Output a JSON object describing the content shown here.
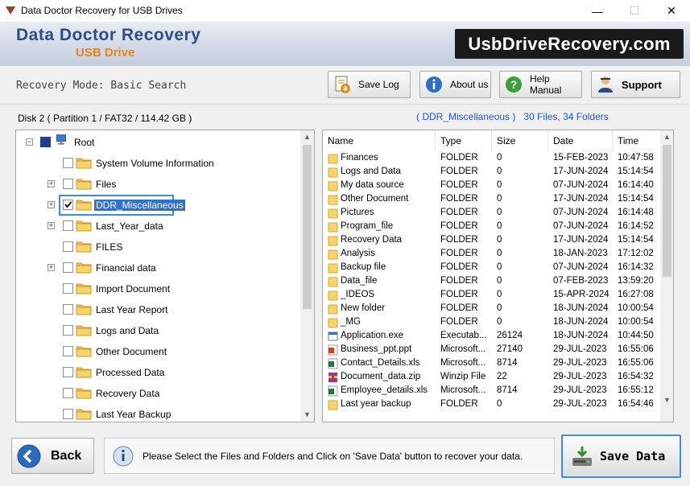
{
  "window": {
    "title": "Data Doctor Recovery for USB Drives",
    "minimize_glyph": "—",
    "maximize_glyph": "☐",
    "close_glyph": "✕"
  },
  "header": {
    "brand": "Data Doctor Recovery",
    "brand_sub": "USB Drive",
    "logo_text": "UsbDriveRecovery.com",
    "brand_color": "#2c4f83",
    "accent_color": "#e7841f"
  },
  "toolbar": {
    "mode": "Recovery Mode: Basic Search",
    "save_log": "Save Log",
    "about_us": "About us",
    "help_manual": "Help Manual",
    "support": "Support"
  },
  "disk": {
    "label": "Disk 2 ( Partition 1 / FAT32 / 114.42 GB )",
    "summary_folder": "( DDR_Miscellaneous )",
    "summary_counts": "30 Files, 34 Folders"
  },
  "tree": {
    "root": "Root",
    "items": [
      {
        "label": "System Volume Information",
        "expandable": false,
        "checked": false,
        "selected": false
      },
      {
        "label": "Files",
        "expandable": true,
        "checked": false,
        "selected": false
      },
      {
        "label": "DDR_Miscellaneous",
        "expandable": true,
        "checked": true,
        "selected": true
      },
      {
        "label": "Last_Year_data",
        "expandable": true,
        "checked": false,
        "selected": false
      },
      {
        "label": "FILES",
        "expandable": false,
        "checked": false,
        "selected": false
      },
      {
        "label": "Financial data",
        "expandable": true,
        "checked": false,
        "selected": false
      },
      {
        "label": "Import Document",
        "expandable": false,
        "checked": false,
        "selected": false
      },
      {
        "label": "Last Year Report",
        "expandable": false,
        "checked": false,
        "selected": false
      },
      {
        "label": "Logs and Data",
        "expandable": false,
        "checked": false,
        "selected": false
      },
      {
        "label": "Other Document",
        "expandable": false,
        "checked": false,
        "selected": false
      },
      {
        "label": "Processed Data",
        "expandable": false,
        "checked": false,
        "selected": false
      },
      {
        "label": "Recovery Data",
        "expandable": false,
        "checked": false,
        "selected": false
      },
      {
        "label": "Last Year Backup",
        "expandable": false,
        "checked": false,
        "selected": false
      }
    ]
  },
  "list": {
    "columns": [
      "Name",
      "Type",
      "Size",
      "Date",
      "Time"
    ],
    "rows": [
      {
        "name": "Finances",
        "type": "FOLDER",
        "size": "0",
        "date": "15-FEB-2023",
        "time": "10:47:58",
        "icon": "folder-icon"
      },
      {
        "name": "Logs and Data",
        "type": "FOLDER",
        "size": "0",
        "date": "17-JUN-2024",
        "time": "15:14:54",
        "icon": "folder-icon"
      },
      {
        "name": "My data source",
        "type": "FOLDER",
        "size": "0",
        "date": "07-JUN-2024",
        "time": "16:14:40",
        "icon": "folder-icon"
      },
      {
        "name": "Other Document",
        "type": "FOLDER",
        "size": "0",
        "date": "17-JUN-2024",
        "time": "15:14:54",
        "icon": "folder-icon"
      },
      {
        "name": "Pictures",
        "type": "FOLDER",
        "size": "0",
        "date": "07-JUN-2024",
        "time": "16:14:48",
        "icon": "folder-icon"
      },
      {
        "name": "Program_file",
        "type": "FOLDER",
        "size": "0",
        "date": "07-JUN-2024",
        "time": "16:14:52",
        "icon": "folder-icon"
      },
      {
        "name": "Recovery Data",
        "type": "FOLDER",
        "size": "0",
        "date": "17-JUN-2024",
        "time": "15:14:54",
        "icon": "folder-icon"
      },
      {
        "name": "Analysis",
        "type": "FOLDER",
        "size": "0",
        "date": "18-JAN-2023",
        "time": "17:12:02",
        "icon": "folder-icon"
      },
      {
        "name": "Backup file",
        "type": "FOLDER",
        "size": "0",
        "date": "07-JUN-2024",
        "time": "16:14:32",
        "icon": "folder-icon"
      },
      {
        "name": "Data_file",
        "type": "FOLDER",
        "size": "0",
        "date": "07-FEB-2023",
        "time": "13:59:20",
        "icon": "folder-icon"
      },
      {
        "name": "_IDEOS",
        "type": "FOLDER",
        "size": "0",
        "date": "15-APR-2024",
        "time": "16:27:08",
        "icon": "folder-icon"
      },
      {
        "name": "New folder",
        "type": "FOLDER",
        "size": "0",
        "date": "18-JUN-2024",
        "time": "10:00:54",
        "icon": "folder-icon"
      },
      {
        "name": "_MG",
        "type": "FOLDER",
        "size": "0",
        "date": "18-JUN-2024",
        "time": "10:00:54",
        "icon": "folder-icon"
      },
      {
        "name": "Application.exe",
        "type": "Executab...",
        "size": "26124",
        "date": "18-JUN-2024",
        "time": "10:44:50",
        "icon": "exe-icon"
      },
      {
        "name": "Business_ppt.ppt",
        "type": "Microsoft...",
        "size": "27140",
        "date": "29-JUL-2023",
        "time": "16:55:06",
        "icon": "ppt-icon"
      },
      {
        "name": "Contact_Details.xls",
        "type": "Microsoft...",
        "size": "8714",
        "date": "29-JUL-2023",
        "time": "16:55:06",
        "icon": "xls-icon"
      },
      {
        "name": "Document_data.zip",
        "type": "Winzip File",
        "size": "22",
        "date": "29-JUL-2023",
        "time": "16:54:32",
        "icon": "zip-icon"
      },
      {
        "name": "Employee_details.xls",
        "type": "Microsoft...",
        "size": "8714",
        "date": "29-JUL-2023",
        "time": "16:55:12",
        "icon": "xls-icon"
      },
      {
        "name": "Last year backup",
        "type": "FOLDER",
        "size": "0",
        "date": "29-JUL-2023",
        "time": "16:54:46",
        "icon": "folder-icon"
      }
    ]
  },
  "bottom": {
    "back": "Back",
    "info": "Please Select the Files and Folders and Click on 'Save Data' button to recover your data.",
    "save_data": "Save Data"
  }
}
